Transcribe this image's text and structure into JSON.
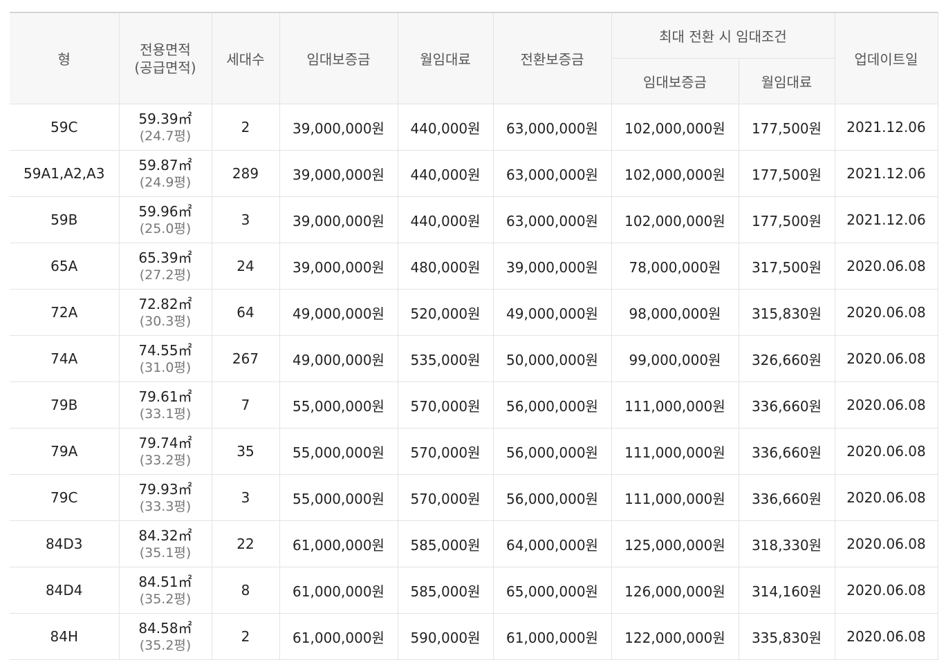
{
  "table": {
    "headers": {
      "type": "형",
      "area_line1": "전용면적",
      "area_line2": "(공급면적)",
      "households": "세대수",
      "deposit": "임대보증금",
      "monthly_rent": "월임대료",
      "conversion_deposit": "전환보증금",
      "max_conversion_group": "최대 전환 시 임대조건",
      "max_deposit": "임대보증금",
      "max_monthly_rent": "월임대료",
      "updated": "업데이트일"
    },
    "rows": [
      {
        "type": "59C",
        "area": "59.39㎡",
        "area_pyeong": "(24.7평)",
        "households": "2",
        "deposit": "39,000,000원",
        "monthly_rent": "440,000원",
        "conversion_deposit": "63,000,000원",
        "max_deposit": "102,000,000원",
        "max_monthly_rent": "177,500원",
        "updated": "2021.12.06"
      },
      {
        "type": "59A1,A2,A3",
        "area": "59.87㎡",
        "area_pyeong": "(24.9평)",
        "households": "289",
        "deposit": "39,000,000원",
        "monthly_rent": "440,000원",
        "conversion_deposit": "63,000,000원",
        "max_deposit": "102,000,000원",
        "max_monthly_rent": "177,500원",
        "updated": "2021.12.06"
      },
      {
        "type": "59B",
        "area": "59.96㎡",
        "area_pyeong": "(25.0평)",
        "households": "3",
        "deposit": "39,000,000원",
        "monthly_rent": "440,000원",
        "conversion_deposit": "63,000,000원",
        "max_deposit": "102,000,000원",
        "max_monthly_rent": "177,500원",
        "updated": "2021.12.06"
      },
      {
        "type": "65A",
        "area": "65.39㎡",
        "area_pyeong": "(27.2평)",
        "households": "24",
        "deposit": "39,000,000원",
        "monthly_rent": "480,000원",
        "conversion_deposit": "39,000,000원",
        "max_deposit": "78,000,000원",
        "max_monthly_rent": "317,500원",
        "updated": "2020.06.08"
      },
      {
        "type": "72A",
        "area": "72.82㎡",
        "area_pyeong": "(30.3평)",
        "households": "64",
        "deposit": "49,000,000원",
        "monthly_rent": "520,000원",
        "conversion_deposit": "49,000,000원",
        "max_deposit": "98,000,000원",
        "max_monthly_rent": "315,830원",
        "updated": "2020.06.08"
      },
      {
        "type": "74A",
        "area": "74.55㎡",
        "area_pyeong": "(31.0평)",
        "households": "267",
        "deposit": "49,000,000원",
        "monthly_rent": "535,000원",
        "conversion_deposit": "50,000,000원",
        "max_deposit": "99,000,000원",
        "max_monthly_rent": "326,660원",
        "updated": "2020.06.08"
      },
      {
        "type": "79B",
        "area": "79.61㎡",
        "area_pyeong": "(33.1평)",
        "households": "7",
        "deposit": "55,000,000원",
        "monthly_rent": "570,000원",
        "conversion_deposit": "56,000,000원",
        "max_deposit": "111,000,000원",
        "max_monthly_rent": "336,660원",
        "updated": "2020.06.08"
      },
      {
        "type": "79A",
        "area": "79.74㎡",
        "area_pyeong": "(33.2평)",
        "households": "35",
        "deposit": "55,000,000원",
        "monthly_rent": "570,000원",
        "conversion_deposit": "56,000,000원",
        "max_deposit": "111,000,000원",
        "max_monthly_rent": "336,660원",
        "updated": "2020.06.08"
      },
      {
        "type": "79C",
        "area": "79.93㎡",
        "area_pyeong": "(33.3평)",
        "households": "3",
        "deposit": "55,000,000원",
        "monthly_rent": "570,000원",
        "conversion_deposit": "56,000,000원",
        "max_deposit": "111,000,000원",
        "max_monthly_rent": "336,660원",
        "updated": "2020.06.08"
      },
      {
        "type": "84D3",
        "area": "84.32㎡",
        "area_pyeong": "(35.1평)",
        "households": "22",
        "deposit": "61,000,000원",
        "monthly_rent": "585,000원",
        "conversion_deposit": "64,000,000원",
        "max_deposit": "125,000,000원",
        "max_monthly_rent": "318,330원",
        "updated": "2020.06.08"
      },
      {
        "type": "84D4",
        "area": "84.51㎡",
        "area_pyeong": "(35.2평)",
        "households": "8",
        "deposit": "61,000,000원",
        "monthly_rent": "585,000원",
        "conversion_deposit": "65,000,000원",
        "max_deposit": "126,000,000원",
        "max_monthly_rent": "314,160원",
        "updated": "2020.06.08"
      },
      {
        "type": "84H",
        "area": "84.58㎡",
        "area_pyeong": "(35.2평)",
        "households": "2",
        "deposit": "61,000,000원",
        "monthly_rent": "590,000원",
        "conversion_deposit": "61,000,000원",
        "max_deposit": "122,000,000원",
        "max_monthly_rent": "335,830원",
        "updated": "2020.06.08"
      }
    ]
  }
}
